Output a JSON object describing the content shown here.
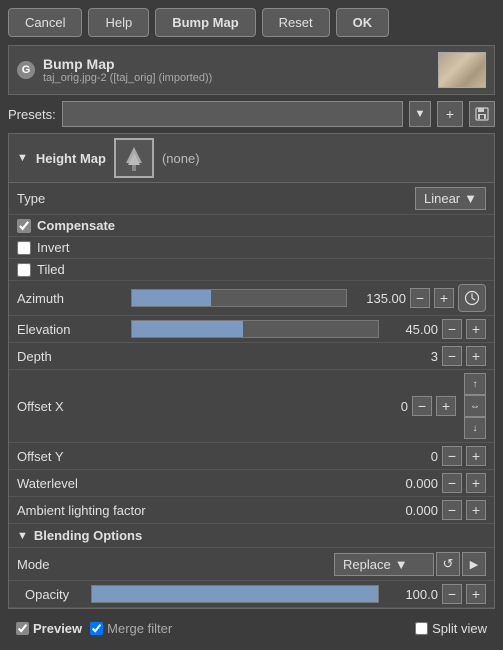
{
  "toolbar": {
    "cancel_label": "Cancel",
    "help_label": "Help",
    "bump_map_label": "Bump Map",
    "reset_label": "Reset",
    "ok_label": "OK"
  },
  "header": {
    "gimp_icon": "G",
    "title": "Bump Map",
    "subtitle": "taj_orig.jpg-2 ([taj_orig] (imported))"
  },
  "presets": {
    "label": "Presets:",
    "placeholder": "",
    "add_icon": "+",
    "save_icon": "💾"
  },
  "height_map": {
    "section_title": "Height Map",
    "none_label": "(none)"
  },
  "type": {
    "label": "Type",
    "value": "Linear"
  },
  "compensate": {
    "label": "Compensate",
    "checked": true
  },
  "invert": {
    "label": "Invert",
    "checked": false
  },
  "tiled": {
    "label": "Tiled",
    "checked": false
  },
  "azimuth": {
    "label": "Azimuth",
    "value": "135.00",
    "fill_pct": 37
  },
  "elevation": {
    "label": "Elevation",
    "value": "45.00",
    "fill_pct": 45
  },
  "depth": {
    "label": "Depth",
    "value": "3"
  },
  "offset_x": {
    "label": "Offset X",
    "value": "0"
  },
  "offset_y": {
    "label": "Offset Y",
    "value": "0"
  },
  "waterlevel": {
    "label": "Waterlevel",
    "value": "0.000"
  },
  "ambient": {
    "label": "Ambient lighting factor",
    "value": "0.000"
  },
  "blending": {
    "section_title": "Blending Options",
    "mode_label": "Mode",
    "mode_value": "Replace",
    "opacity_label": "Opacity",
    "opacity_value": "100.0"
  },
  "footer": {
    "preview_label": "Preview",
    "merge_label": "Merge filter",
    "split_label": "Split view",
    "preview_checked": true,
    "merge_checked": true,
    "split_checked": false
  }
}
